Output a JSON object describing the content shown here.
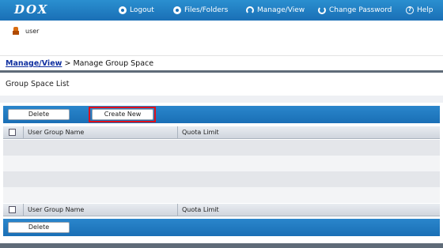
{
  "header": {
    "logo": "DOX",
    "nav": [
      {
        "label": "Logout",
        "icon": "logout-icon"
      },
      {
        "label": "Files/Folders",
        "icon": "folders-icon"
      },
      {
        "label": "Manage/View",
        "icon": "manage-view-icon"
      },
      {
        "label": "Change Password",
        "icon": "change-password-icon"
      },
      {
        "label": "Help",
        "icon": "help-icon"
      }
    ]
  },
  "user": {
    "name": "user"
  },
  "breadcrumb": {
    "link": "Manage/View",
    "separator": ">",
    "current": "Manage Group Space"
  },
  "section": {
    "title": "Group Space List"
  },
  "toolbar_top": {
    "delete_label": "Delete",
    "create_label": "Create New"
  },
  "table": {
    "columns": [
      "User Group Name",
      "Quota Limit"
    ],
    "rows": []
  },
  "toolbar_bottom": {
    "delete_label": "Delete"
  },
  "colors": {
    "header": "#1a6fb6",
    "highlight": "#e0101a",
    "link": "#1030a0"
  }
}
